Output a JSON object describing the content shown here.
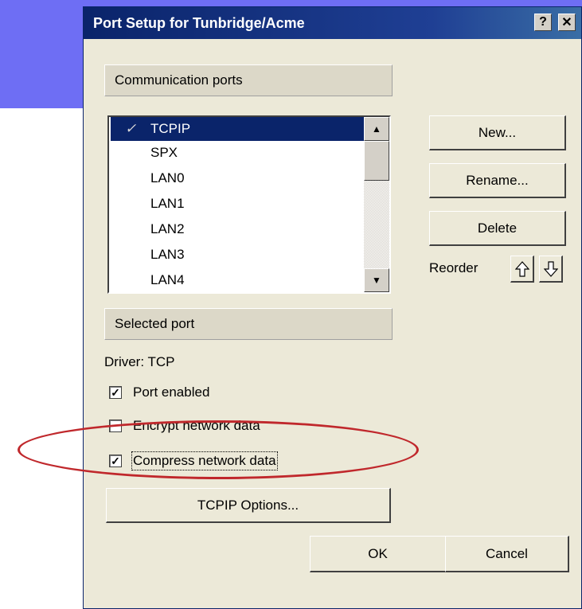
{
  "window": {
    "title": "Port Setup for Tunbridge/Acme",
    "help_glyph": "?",
    "close_glyph": "✕"
  },
  "communication": {
    "header": "Communication ports",
    "ports": [
      {
        "label": "TCPIP",
        "selected": true,
        "checked": true
      },
      {
        "label": "SPX"
      },
      {
        "label": "LAN0"
      },
      {
        "label": "LAN1"
      },
      {
        "label": "LAN2"
      },
      {
        "label": "LAN3"
      },
      {
        "label": "LAN4"
      }
    ]
  },
  "buttons": {
    "new": "New...",
    "rename": "Rename...",
    "delete": "Delete",
    "reorder": "Reorder",
    "tcpip_options": "TCPIP Options...",
    "ok": "OK",
    "cancel": "Cancel"
  },
  "selected_port": {
    "header": "Selected port",
    "driver": "Driver: TCP",
    "options": [
      {
        "label": "Port enabled",
        "checked": true
      },
      {
        "label": "Encrypt network data",
        "checked": false
      },
      {
        "label": "Compress network data",
        "checked": true
      }
    ]
  },
  "colors": {
    "titlebar": "#0a246a",
    "selection": "#0a246a",
    "background": "#6e6ef4",
    "annotation": "#c0282c"
  },
  "icons": [
    "help-icon",
    "close-icon",
    "scroll-up-icon",
    "scroll-down-icon",
    "reorder-up-icon",
    "reorder-down-icon",
    "check-icon"
  ]
}
